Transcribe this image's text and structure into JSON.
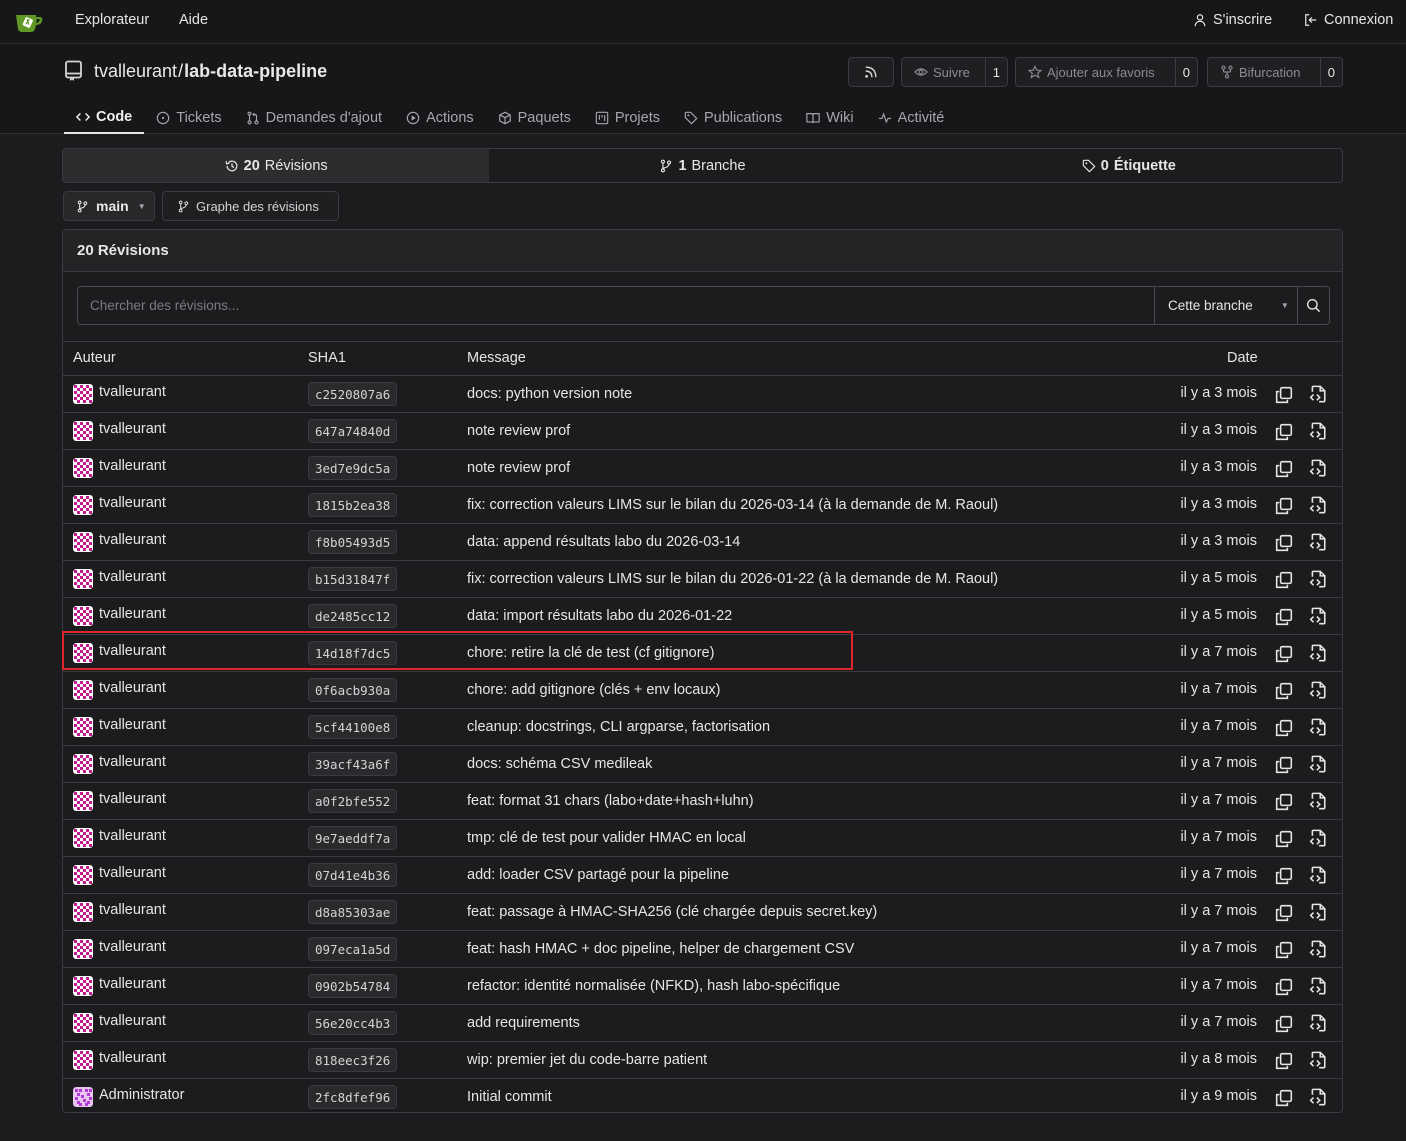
{
  "topnav": {
    "explore": "Explorateur",
    "help": "Aide",
    "register": "S'inscrire",
    "login": "Connexion"
  },
  "repo": {
    "owner": "tvalleurant",
    "separator": "/",
    "name": "lab-data-pipeline",
    "watch_label": "Suivre",
    "watch_count": "1",
    "star_label": "Ajouter aux favoris",
    "star_count": "0",
    "fork_label": "Bifurcation",
    "fork_count": "0"
  },
  "tabs": [
    {
      "label": "Code",
      "icon": "code-icon"
    },
    {
      "label": "Tickets",
      "icon": "issue-icon"
    },
    {
      "label": "Demandes d'ajout",
      "icon": "pull-request-icon"
    },
    {
      "label": "Actions",
      "icon": "play-icon"
    },
    {
      "label": "Paquets",
      "icon": "package-icon"
    },
    {
      "label": "Projets",
      "icon": "project-icon"
    },
    {
      "label": "Publications",
      "icon": "tag-icon"
    },
    {
      "label": "Wiki",
      "icon": "book-icon"
    },
    {
      "label": "Activité",
      "icon": "pulse-icon"
    }
  ],
  "stats": {
    "revisions_count": "20",
    "revisions_label": "Révisions",
    "branches_count": "1",
    "branches_label": "Branche",
    "tags_count": "0",
    "tags_label": "Étiquette"
  },
  "branch": {
    "current": "main",
    "graph_label": "Graphe des révisions"
  },
  "commits": {
    "header": "20 Révisions",
    "search_placeholder": "Chercher des révisions...",
    "scope_select": "Cette branche",
    "columns": {
      "author": "Auteur",
      "sha": "SHA1",
      "message": "Message",
      "date": "Date"
    },
    "rows": [
      {
        "author": "tvalleurant",
        "sha": "c2520807a6",
        "message": "docs: python version note",
        "date": "il y a 3 mois"
      },
      {
        "author": "tvalleurant",
        "sha": "647a74840d",
        "message": "note review prof",
        "date": "il y a 3 mois"
      },
      {
        "author": "tvalleurant",
        "sha": "3ed7e9dc5a",
        "message": "note review prof",
        "date": "il y a 3 mois"
      },
      {
        "author": "tvalleurant",
        "sha": "1815b2ea38",
        "message": "fix: correction valeurs LIMS sur le bilan du 2026-03-14 (à la demande de M. Raoul)",
        "date": "il y a 3 mois"
      },
      {
        "author": "tvalleurant",
        "sha": "f8b05493d5",
        "message": "data: append résultats labo du 2026-03-14",
        "date": "il y a 3 mois"
      },
      {
        "author": "tvalleurant",
        "sha": "b15d31847f",
        "message": "fix: correction valeurs LIMS sur le bilan du 2026-01-22 (à la demande de M. Raoul)",
        "date": "il y a 5 mois"
      },
      {
        "author": "tvalleurant",
        "sha": "de2485cc12",
        "message": "data: import résultats labo du 2026-01-22",
        "date": "il y a 5 mois"
      },
      {
        "author": "tvalleurant",
        "sha": "14d18f7dc5",
        "message": "chore: retire la clé de test (cf gitignore)",
        "date": "il y a 7 mois"
      },
      {
        "author": "tvalleurant",
        "sha": "0f6acb930a",
        "message": "chore: add gitignore (clés + env locaux)",
        "date": "il y a 7 mois"
      },
      {
        "author": "tvalleurant",
        "sha": "5cf44100e8",
        "message": "cleanup: docstrings, CLI argparse, factorisation",
        "date": "il y a 7 mois"
      },
      {
        "author": "tvalleurant",
        "sha": "39acf43a6f",
        "message": "docs: schéma CSV medileak",
        "date": "il y a 7 mois"
      },
      {
        "author": "tvalleurant",
        "sha": "a0f2bfe552",
        "message": "feat: format 31 chars (labo+date+hash+luhn)",
        "date": "il y a 7 mois"
      },
      {
        "author": "tvalleurant",
        "sha": "9e7aeddf7a",
        "message": "tmp: clé de test pour valider HMAC en local",
        "date": "il y a 7 mois"
      },
      {
        "author": "tvalleurant",
        "sha": "07d41e4b36",
        "message": "add: loader CSV partagé pour la pipeline",
        "date": "il y a 7 mois"
      },
      {
        "author": "tvalleurant",
        "sha": "d8a85303ae",
        "message": "feat: passage à HMAC-SHA256 (clé chargée depuis secret.key)",
        "date": "il y a 7 mois"
      },
      {
        "author": "tvalleurant",
        "sha": "097eca1a5d",
        "message": "feat: hash HMAC + doc pipeline, helper de chargement CSV",
        "date": "il y a 7 mois"
      },
      {
        "author": "tvalleurant",
        "sha": "0902b54784",
        "message": "refactor: identité normalisée (NFKD), hash labo-spécifique",
        "date": "il y a 7 mois"
      },
      {
        "author": "tvalleurant",
        "sha": "56e20cc4b3",
        "message": "add requirements",
        "date": "il y a 7 mois"
      },
      {
        "author": "tvalleurant",
        "sha": "818eec3f26",
        "message": "wip: premier jet du code-barre patient",
        "date": "il y a 8 mois"
      },
      {
        "author": "Administrator",
        "sha": "2fc8dfef96",
        "message": "Initial commit",
        "date": "il y a 9 mois"
      }
    ]
  },
  "colors": {
    "background": "#1c1c1e",
    "header_bg": "#171719",
    "border": "#3b3b3f",
    "text": "#e6e6e6",
    "logo_green": "#609926",
    "avatar_magenta": "#c01a8c",
    "highlight_red": "#e0262b"
  }
}
